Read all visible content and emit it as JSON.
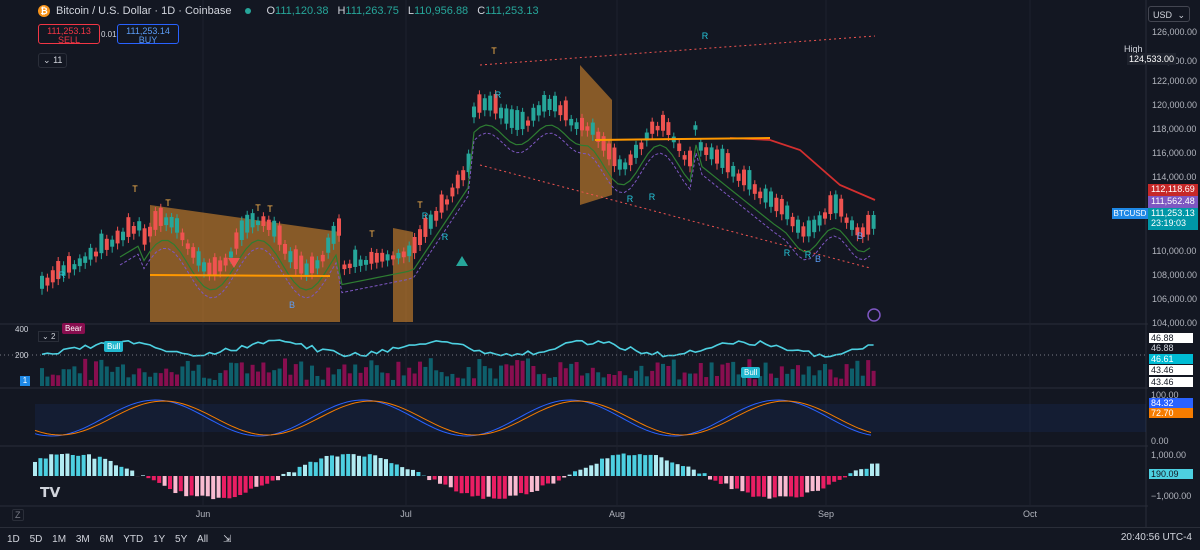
{
  "header": {
    "symbol_title": "Bitcoin / U.S. Dollar · 1D · Coinbase",
    "ohlc": [
      {
        "k": "O",
        "v": "111,120.38"
      },
      {
        "k": "H",
        "v": "111,263.75"
      },
      {
        "k": "L",
        "v": "110,956.88"
      },
      {
        "k": "C",
        "v": "111,253.13"
      }
    ],
    "sell_price": "111,253.13",
    "sell_label": "SELL",
    "buy_price": "111,253.14",
    "buy_label": "BUY",
    "spread": "0.01",
    "indicator_count": "11"
  },
  "currency": "USD",
  "price_axis": {
    "labels": [
      "126,000.00",
      "124,000.00",
      "122,000.00",
      "120,000.00",
      "118,000.00",
      "116,000.00",
      "114,000.00",
      "110,000.00",
      "108,000.00",
      "106,000.00",
      "104,000.00"
    ],
    "high_label": "High",
    "high_value": "124,533.00",
    "tag_red": "112,118.69",
    "tag_purple": "111,562.48",
    "symbol_tag": "BTCUSD",
    "last_price": "111,253.13",
    "countdown": "23:19:03"
  },
  "pane1": {
    "left_labels": [
      "400",
      "200"
    ],
    "collapse": "2",
    "badge": "1",
    "bear_tag": "Bear",
    "bull_tag": "Bull",
    "values": [
      "46.88",
      "46.88",
      "46.61",
      "43.46",
      "43.46"
    ]
  },
  "pane2": {
    "axis_top": "100.00",
    "value_blue": "84.32",
    "value_orange": "72.70",
    "axis_bottom": "0.00"
  },
  "pane3": {
    "axis_top": "1,000.00",
    "value": "190.09",
    "axis_bottom": "−1,000.00"
  },
  "time_axis": {
    "labels": [
      "Jun",
      "Jul",
      "Aug",
      "Sep",
      "Oct"
    ]
  },
  "chart_markers": {
    "T": "T",
    "R": "R",
    "B": "B"
  },
  "bottom_bar": {
    "timeframes": [
      "1D",
      "5D",
      "1M",
      "3M",
      "6M",
      "YTD",
      "1Y",
      "5Y",
      "All"
    ],
    "clock": "20:40:56 UTC-4"
  },
  "colors": {
    "bg": "#131722",
    "up": "#26a69a",
    "down": "#ef5350",
    "accent": "#2962ff",
    "orange": "#e8912d"
  }
}
